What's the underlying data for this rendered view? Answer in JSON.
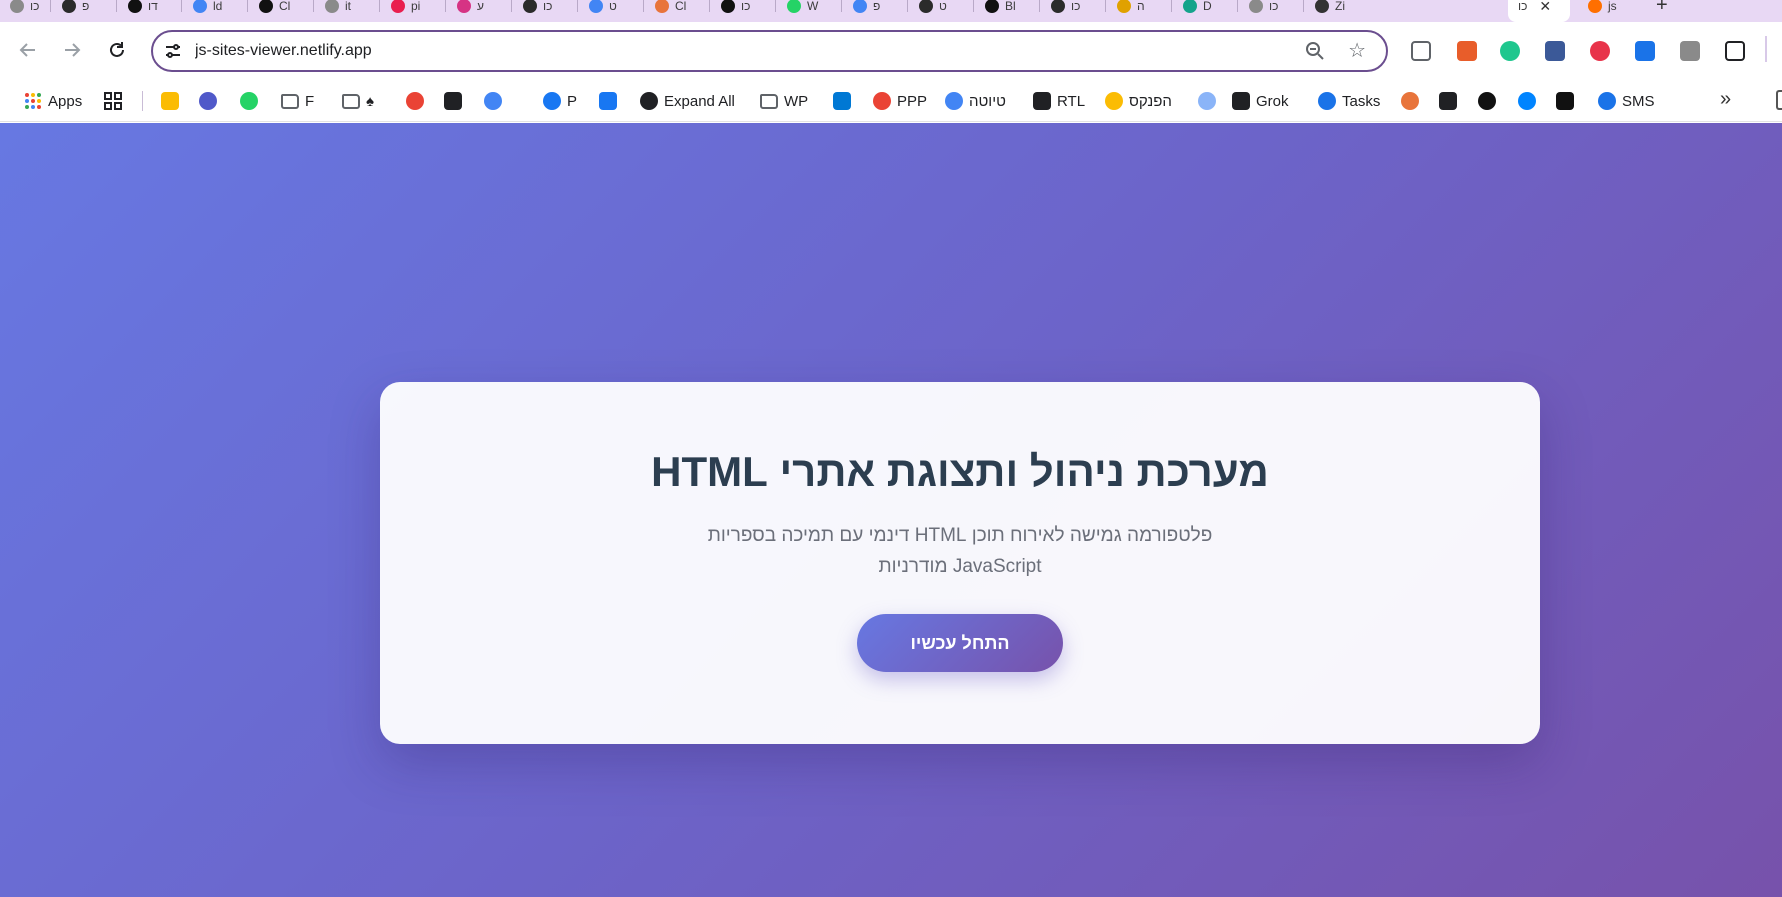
{
  "browser": {
    "tabs": [
      {
        "label": "כו",
        "color": "#8a8a8a"
      },
      {
        "label": "פ",
        "color": "#2b2b2b"
      },
      {
        "label": "דו",
        "color": "#111111"
      },
      {
        "label": "ld",
        "color": "#4285f4"
      },
      {
        "label": "Cl",
        "color": "#111111"
      },
      {
        "label": "it",
        "color": "#8a8a8a"
      },
      {
        "label": "pi",
        "color": "#e91e4f"
      },
      {
        "label": "ע",
        "color": "#d63384"
      },
      {
        "label": "כו",
        "color": "#2b2b2b"
      },
      {
        "label": "ט",
        "color": "#4285f4"
      },
      {
        "label": "Cl",
        "color": "#e8743b"
      },
      {
        "label": "כו",
        "color": "#111111"
      },
      {
        "label": "W",
        "color": "#25d366"
      },
      {
        "label": "פ",
        "color": "#4285f4"
      },
      {
        "label": "ט",
        "color": "#2b2b2b"
      },
      {
        "label": "Bl",
        "color": "#111111"
      },
      {
        "label": "כו",
        "color": "#2b2b2b"
      },
      {
        "label": "ה",
        "color": "#e0a100"
      },
      {
        "label": "D",
        "color": "#14a38b"
      },
      {
        "label": "כו",
        "color": "#8a8a8a"
      },
      {
        "label": "Zi",
        "color": "#333333"
      }
    ],
    "active_tab": {
      "label": "כו",
      "close": "✕"
    },
    "after_tab": {
      "label": "js",
      "color": "#ff6f00"
    },
    "new_tab": "+",
    "address": "js-sites-viewer.netlify.app",
    "extensions": [
      "#5f6368",
      "#e85d2a",
      "#1fc78e",
      "#3b5998",
      "#e8334a",
      "#1a73e8",
      "#8a8a8a",
      "#202124"
    ]
  },
  "bookmarks": {
    "apps_label": "Apps",
    "items": [
      {
        "label": "",
        "color": "#fbbc04"
      },
      {
        "label": "",
        "color": "#5059c9"
      },
      {
        "label": "",
        "color": "#25d366"
      },
      {
        "label": "F",
        "color": "folder"
      },
      {
        "label": "♠",
        "color": "folder"
      },
      {
        "label": "",
        "color": "#ea4335"
      },
      {
        "label": "",
        "color": "#202124"
      },
      {
        "label": "",
        "color": "#4285f4"
      },
      {
        "label": "P",
        "color": "#1877f2"
      },
      {
        "label": "",
        "color": "#1877f2"
      },
      {
        "label": "Expand All",
        "color": "#202124"
      },
      {
        "label": "WP",
        "color": "folder"
      },
      {
        "label": "",
        "color": "#0078d4"
      },
      {
        "label": "PPP",
        "color": "#ea4335"
      },
      {
        "label": "טיוטה",
        "color": "#4285f4"
      },
      {
        "label": "RTL",
        "color": "#202124"
      },
      {
        "label": "הפנקס",
        "color": "#fbbc04"
      },
      {
        "label": "",
        "color": "#8ab4f8"
      },
      {
        "label": "Grok",
        "color": "#202124"
      },
      {
        "label": "Tasks",
        "color": "#1a73e8"
      },
      {
        "label": "",
        "color": "#e8743b"
      },
      {
        "label": "",
        "color": "#202124"
      },
      {
        "label": "",
        "color": "#111111"
      },
      {
        "label": "",
        "color": "#0084ff"
      },
      {
        "label": "",
        "color": "#111111"
      },
      {
        "label": "SMS",
        "color": "#1a73e8"
      }
    ],
    "more": "»"
  },
  "hero": {
    "title": "מערכת ניהול ותצוגת אתרי HTML",
    "subtitle": "פלטפורמה גמישה לאירוח תוכן HTML דינמי עם תמיכה בספריות JavaScript מודרניות",
    "cta_label": "התחל עכשיו"
  }
}
